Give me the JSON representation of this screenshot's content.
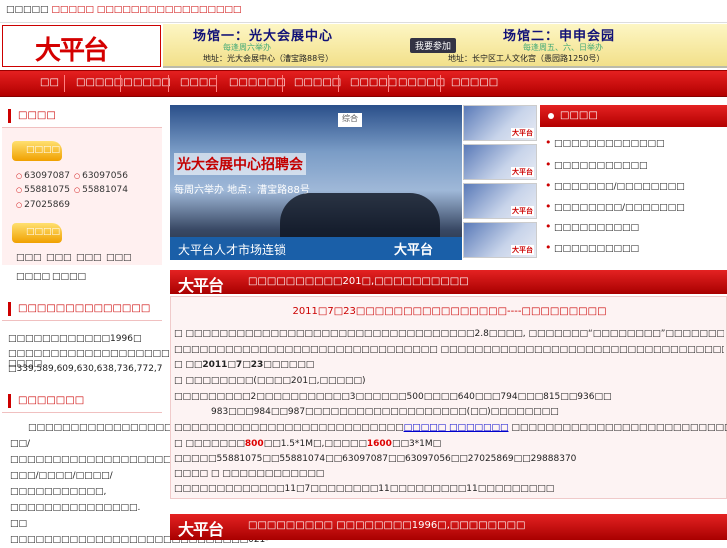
{
  "topbar": {
    "prefix": "□□□□□",
    "red_text": "□□□□□ □□□□□□□□□□□□□□□□□"
  },
  "logo": {
    "text": "大平台"
  },
  "banner": {
    "venue1": "场馆一：光大会展中心",
    "venue2": "场馆二：申申会园",
    "schedule1": "每逢周六举办",
    "schedule2": "每逢周五、六、日举办",
    "join_button": "我要参加",
    "address1": "地址：光大会展中心（漕宝路88号）",
    "address2": "地址：长宁区工人文化宫（愚园路1250号）"
  },
  "nav": {
    "items": [
      "□□",
      "□□□□□□",
      "□□□□",
      "□□□□",
      "□□□□□□",
      "□□□□□",
      "□□□□□",
      "□□□□□",
      "□□□□□"
    ]
  },
  "sidebar1": {
    "title": "□□□□",
    "tab1": "□□□□",
    "phones": [
      "63097087",
      "63097056",
      "55881075",
      "55881074",
      "27025869"
    ],
    "tab2": "□□□□",
    "links": [
      "□□□",
      "□□□",
      "□□□",
      "□□□",
      "□□□□",
      "□□□□"
    ]
  },
  "sidebar2": {
    "title": "□□□□□□□□□□□□□□",
    "line1": "□□□□□□□□□□□□1996□",
    "line2": "□□□□□□□□□□□□□□□□□□□ □□□□",
    "line3": "□339,589,609,630,638,736,772,7"
  },
  "sidebar3": {
    "title": "□□□□□□□",
    "paragraph": "□□□□□□□□□□□□□□□□□□□□□□□□□□□□□□□□□□□□□□□□□/□□/□□□□□□□□□□□□□□□□□□□□□□□□□□□□□□□□□□□□□□□□/□□□/□□□□/□□□□/□□□□□□□□□□□, □□□□□□□□□□□□□□□. □□ □□□□□□□□□□□□□□□□□□□□□□□□□□□□021-"
  },
  "photo": {
    "title": "光大会展中心招聘会",
    "subtitle": "每周六举办 地点：漕宝路88号",
    "sign": "综合",
    "caption": "大平台人才市场连锁",
    "logo": "大平台"
  },
  "thumb_logo": "大平台",
  "news": {
    "title": "□□□□",
    "items": [
      "□□□□□□□□□□□□□",
      "□□□□□□□□□□□",
      "□□□□□□□/□□□□□□□□",
      "□□□□□□□□/□□□□□□□",
      "□□□□□□□□□□",
      "□□□□□□□□□□"
    ]
  },
  "section1": {
    "logo": "大平台",
    "title": "□□□□□□□□□□201□,□□□□□□□□□□"
  },
  "content": {
    "title": "2011□7□23□□□□□□□□□□□□□□□□----□□□□□□□□□",
    "line1": "□      □□□□□□□□□□□□□□□□□□□□□□□□□□□□□□□□□□2.8□□□□, □□□□□□□“□□□□□□□□”□□□□□□□□□□□□□□□□□□□□□□□□□□□□□□□□",
    "line2": "□□□□□□□□□□□□□□□□□□□□□□□□□□□□□□□ □□□□□□□□□□□□□□□□□□□□□□□□□□□□□□□□□□□□□□ □□□□□□□□500□□□□□□□□□□□□□□□□□□□□",
    "line3a": "□      □□",
    "line3b": "2011□7□23□",
    "line3c": "□□□□□",
    "line4": "□      □□□□□□□□(□□□□201□,□□□□□)",
    "line5": "□□□□□□□□□2□□□□□□□□□□□3□□□□□□500□□□□640□□□794□□□815□□936□□",
    "line6": "983□□□984□□987□□□□□□□□□□□□□□□□□□□(□□)□□□□□□□□",
    "line7a": "□□□□□□□□□□□□□□□□□□□□□□□□□□□",
    "line7b": "□□□□□ □□□□□□□",
    "line7c": " □□□□□□□□□□□□□□□□□□□□□□□□□□□□□",
    "line8a": "□      □□□□□□□",
    "line8b": "800",
    "line8c": "□□1.5*1M□,□□□□□",
    "line8d": "1600",
    "line8e": "□□3*1M□",
    "line9": "□□□□□55881075□□55881074□□63097087□□63097056□□27025869□□29888370",
    "line10": "□□□□ □  □□□□□□□□□□□□",
    "line11": "□□□□□□□□□□□□□11□7□□□□□□□□11□□□□□□□□□11□□□□□□□□□"
  },
  "section2": {
    "logo": "大平台",
    "title": "□□□□□□□□□ □□□□□□□□1996□,□□□□□□□□"
  }
}
